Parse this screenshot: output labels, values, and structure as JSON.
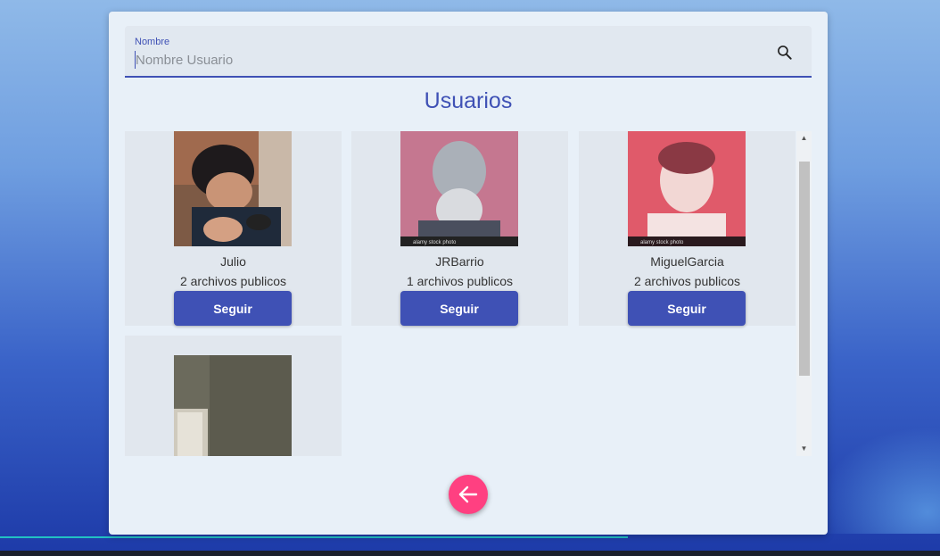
{
  "search": {
    "label": "Nombre",
    "placeholder": "Nombre Usuario",
    "value": ""
  },
  "heading": "Usuarios",
  "users": [
    {
      "name": "Julio",
      "files": "2 archivos publicos",
      "button": "Seguir"
    },
    {
      "name": "JRBarrio",
      "files": "1 archivos publicos",
      "button": "Seguir"
    },
    {
      "name": "MiguelGarcia",
      "files": "2 archivos publicos",
      "button": "Seguir"
    },
    {
      "name": "",
      "files": "",
      "button": ""
    }
  ],
  "photo_watermark": "alamy stock photo",
  "icons": {
    "search": "search-icon",
    "back": "arrow-back-icon",
    "scroll_up": "scroll-up-arrow-icon",
    "scroll_down": "scroll-down-arrow-icon"
  },
  "colors": {
    "primary": "#3f51b5",
    "accent": "#ff4081",
    "panel": "#e8f0f8",
    "card": "#e1e7ee"
  }
}
